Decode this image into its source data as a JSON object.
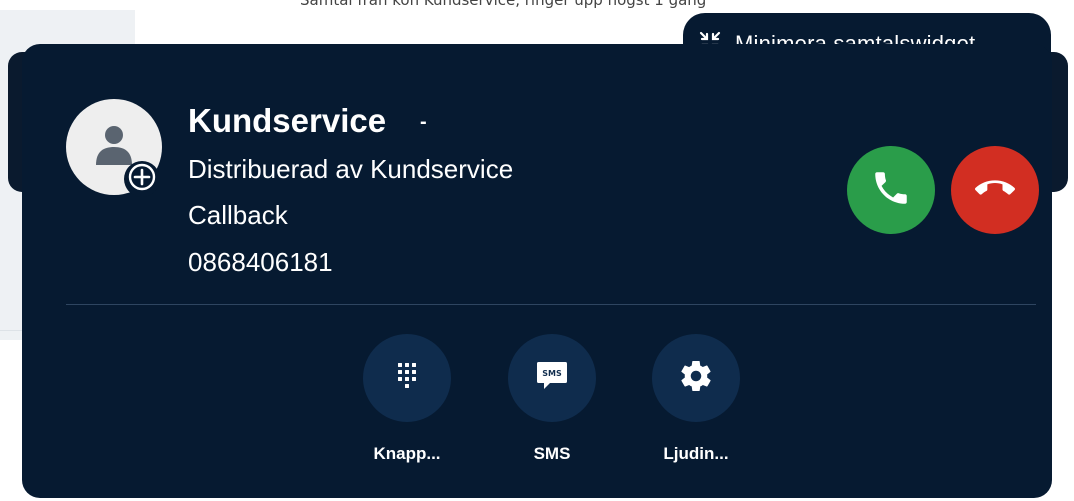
{
  "top_bar": {
    "partial_text": "Samtal från kön Kundservice, ringer upp högst 1 gång"
  },
  "minimize": {
    "label": "Minimera samtalswidget",
    "icon": "collapse-arrows-icon"
  },
  "caller": {
    "name": "Kundservice",
    "chevron": "-",
    "distributed_by": "Distribuerad av Kundservice",
    "call_type": "Callback",
    "phone_number": "0868406181",
    "avatar_icon": "user-icon",
    "add_icon": "add-contact-icon"
  },
  "call_controls": {
    "answer_icon": "phone-answer-icon",
    "hangup_icon": "phone-hangup-icon",
    "answer_color": "#2a9d4a",
    "hangup_color": "#d22e22"
  },
  "actions": [
    {
      "label": "Knapp...",
      "icon": "keypad-icon"
    },
    {
      "label": "SMS",
      "icon": "sms-icon"
    },
    {
      "label": "Ljudin...",
      "icon": "gear-icon"
    }
  ],
  "colors": {
    "widget_bg": "#061a31",
    "action_bg": "#0f2c4d"
  }
}
